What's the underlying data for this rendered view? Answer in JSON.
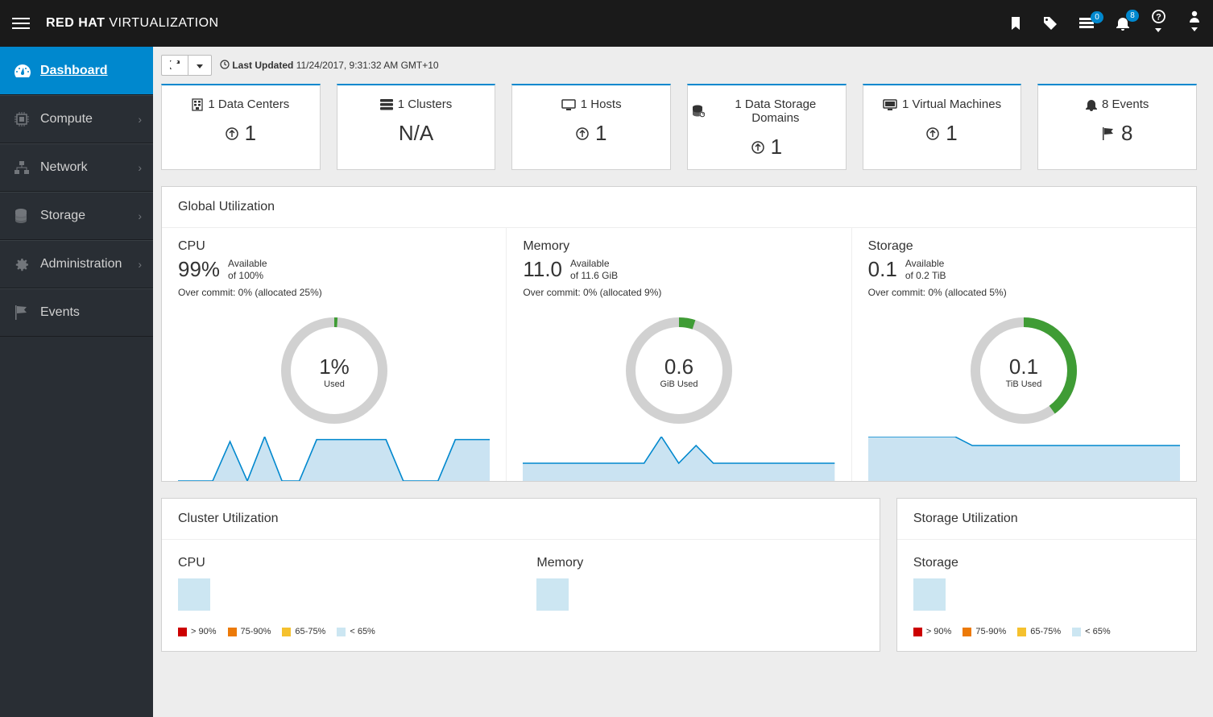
{
  "brand": {
    "bold": "RED HAT",
    "light": " VIRTUALIZATION"
  },
  "header": {
    "notifications_badge": "0",
    "bell_badge": "8"
  },
  "sidebar": {
    "items": [
      {
        "label": "Dashboard"
      },
      {
        "label": "Compute"
      },
      {
        "label": "Network"
      },
      {
        "label": "Storage"
      },
      {
        "label": "Administration"
      },
      {
        "label": "Events"
      }
    ]
  },
  "toolbar": {
    "last_updated_label": "Last Updated",
    "last_updated_value": "11/24/2017, 9:31:32 AM GMT+10"
  },
  "cards": [
    {
      "count": "1",
      "label": "Data Centers",
      "body_count": "1",
      "body_type": "status"
    },
    {
      "count": "1",
      "label": "Clusters",
      "body_text": "N/A",
      "body_type": "text"
    },
    {
      "count": "1",
      "label": "Hosts",
      "body_count": "1",
      "body_type": "status"
    },
    {
      "count": "1",
      "label": "Data Storage Domains",
      "body_count": "1",
      "body_type": "status"
    },
    {
      "count": "1",
      "label": "Virtual Machines",
      "body_count": "1",
      "body_type": "status"
    },
    {
      "count": "8",
      "label": "Events",
      "body_count": "8",
      "body_type": "flag"
    }
  ],
  "global_util": {
    "title": "Global Utilization",
    "cells": [
      {
        "title": "CPU",
        "big": "99%",
        "small1": "Available",
        "small2": "of 100%",
        "overcommit": "Over commit: 0% (allocated 25%)",
        "donut_val": "1%",
        "donut_sub": "Used",
        "donut_pct": 1
      },
      {
        "title": "Memory",
        "big": "11.0",
        "small1": "Available",
        "small2": "of 11.6 GiB",
        "overcommit": "Over commit: 0% (allocated 9%)",
        "donut_val": "0.6",
        "donut_sub": "GiB Used",
        "donut_pct": 5
      },
      {
        "title": "Storage",
        "big": "0.1",
        "small1": "Available",
        "small2": "of 0.2 TiB",
        "overcommit": "Over commit: 0% (allocated 5%)",
        "donut_val": "0.1",
        "donut_sub": "TiB Used",
        "donut_pct": 40
      }
    ]
  },
  "cluster_util": {
    "title": "Cluster Utilization",
    "cells": [
      {
        "title": "CPU"
      },
      {
        "title": "Memory"
      }
    ]
  },
  "storage_util": {
    "title": "Storage Utilization",
    "cell_title": "Storage"
  },
  "legend": [
    {
      "color": "#cc0000",
      "label": "> 90%"
    },
    {
      "color": "#ec7a08",
      "label": "75-90%"
    },
    {
      "color": "#f5c12e",
      "label": "65-75%"
    },
    {
      "color": "#cce6f2",
      "label": "< 65%"
    }
  ],
  "chart_data": {
    "donuts": [
      {
        "name": "CPU",
        "used_pct": 1,
        "free_pct": 99,
        "label": "1%",
        "sub": "Used"
      },
      {
        "name": "Memory",
        "used": 0.6,
        "total": 11.6,
        "unit": "GiB",
        "used_pct": 5,
        "label": "0.6",
        "sub": "GiB Used"
      },
      {
        "name": "Storage",
        "used": 0.1,
        "total": 0.2,
        "unit": "TiB",
        "used_pct": 40,
        "label": "0.1",
        "sub": "TiB Used"
      }
    ],
    "sparklines": [
      {
        "name": "CPU",
        "points": [
          0,
          0,
          0,
          40,
          0,
          45,
          0,
          0,
          42,
          42,
          42,
          42,
          42,
          0,
          0,
          0,
          42,
          42,
          42
        ]
      },
      {
        "name": "Memory",
        "points": [
          6,
          6,
          6,
          6,
          6,
          6,
          6,
          6,
          15,
          6,
          12,
          6,
          6,
          6,
          6,
          6,
          6,
          6,
          6
        ]
      },
      {
        "name": "Storage",
        "points": [
          10,
          10,
          10,
          10,
          10,
          10,
          8,
          8,
          8,
          8,
          8,
          8,
          8,
          8,
          8,
          8,
          8,
          8,
          8
        ]
      }
    ]
  }
}
